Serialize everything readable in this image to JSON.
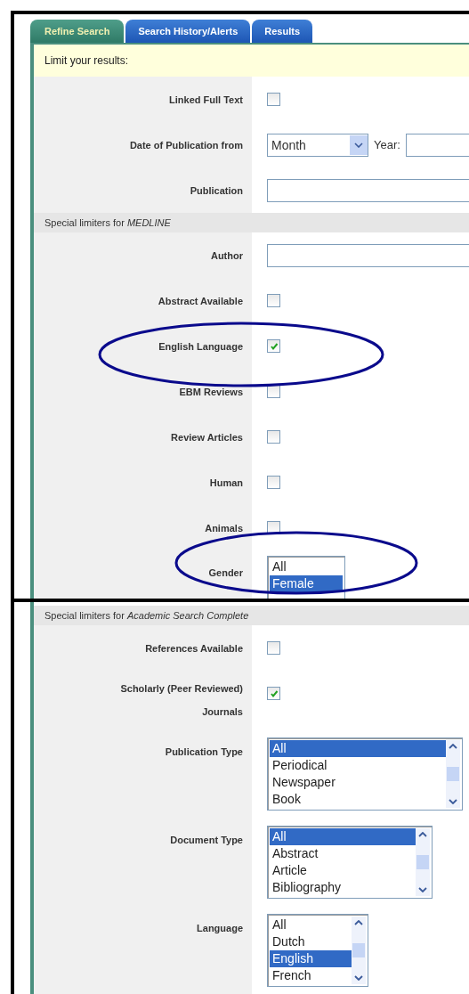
{
  "tabs": [
    {
      "label": "Refine Search",
      "selected": true
    },
    {
      "label": "Search History/Alerts",
      "selected": false
    },
    {
      "label": "Results",
      "selected": false
    }
  ],
  "banner": "Limit your results:",
  "top_rows": [
    {
      "kind": "checkbox",
      "label": "Linked Full Text",
      "checked": false
    },
    {
      "kind": "date",
      "label": "Date of Publication from",
      "select_value": "Month",
      "year_label": "Year:"
    },
    {
      "kind": "text",
      "label": "Publication"
    },
    {
      "kind": "section",
      "title": "Special limiters for *MEDLINE*"
    },
    {
      "kind": "text",
      "label": "Author"
    },
    {
      "kind": "checkbox",
      "label": "Abstract Available",
      "checked": false
    },
    {
      "kind": "checkbox",
      "label": "English Language",
      "checked": true
    },
    {
      "kind": "checkbox",
      "label": "EBM Reviews",
      "checked": false
    },
    {
      "kind": "checkbox",
      "label": "Review Articles",
      "checked": false
    },
    {
      "kind": "checkbox",
      "label": "Human",
      "checked": false
    },
    {
      "kind": "checkbox",
      "label": "Animals",
      "checked": false
    },
    {
      "kind": "listbox",
      "label": "Gender",
      "scrollable": false,
      "options": [
        {
          "text": "All",
          "selected": false
        },
        {
          "text": "Female",
          "selected": true
        }
      ]
    }
  ],
  "bottom_rows": [
    {
      "kind": "section",
      "title": "Special limiters for *Academic Search Complete*"
    },
    {
      "kind": "checkbox",
      "label": "References Available",
      "checked": false
    },
    {
      "kind": "checkbox",
      "label": "Scholarly (Peer Reviewed) Journals",
      "checked": true
    },
    {
      "kind": "listbox",
      "label": "Publication Type",
      "scrollable": true,
      "options": [
        {
          "text": "All",
          "selected": true
        },
        {
          "text": "Periodical",
          "selected": false
        },
        {
          "text": "Newspaper",
          "selected": false
        },
        {
          "text": "Book",
          "selected": false
        }
      ]
    },
    {
      "kind": "listbox",
      "label": "Document Type",
      "scrollable": true,
      "options": [
        {
          "text": "All",
          "selected": true
        },
        {
          "text": "Abstract",
          "selected": false
        },
        {
          "text": "Article",
          "selected": false
        },
        {
          "text": "Bibliography",
          "selected": false
        }
      ]
    },
    {
      "kind": "listbox",
      "label": "Language",
      "scrollable": true,
      "options": [
        {
          "text": "All",
          "selected": false
        },
        {
          "text": "Dutch",
          "selected": false
        },
        {
          "text": "English",
          "selected": true
        },
        {
          "text": "French",
          "selected": false
        }
      ]
    }
  ]
}
